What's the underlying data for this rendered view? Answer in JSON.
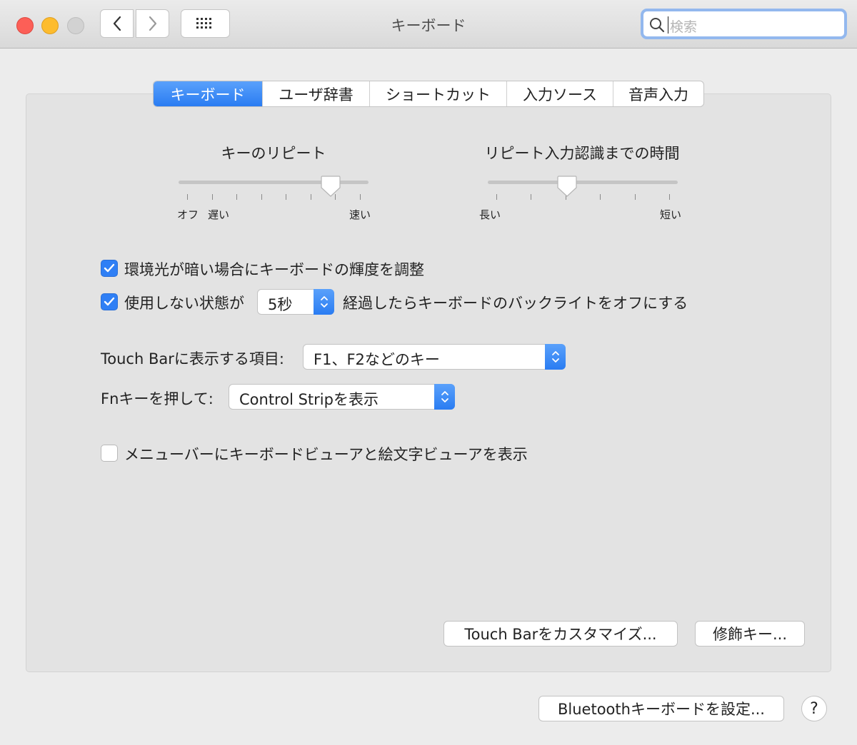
{
  "window": {
    "title": "キーボード"
  },
  "toolbar": {
    "back_icon": "chevron-left-icon",
    "forward_icon": "chevron-right-icon",
    "grid_icon": "grid-icon",
    "search_placeholder": "検索"
  },
  "tabs": [
    {
      "label": "キーボード",
      "active": true
    },
    {
      "label": "ユーザ辞書",
      "active": false
    },
    {
      "label": "ショートカット",
      "active": false
    },
    {
      "label": "入力ソース",
      "active": false
    },
    {
      "label": "音声入力",
      "active": false
    }
  ],
  "key_repeat": {
    "title": "キーのリピート",
    "label_off": "オフ",
    "label_slow": "遅い",
    "label_fast": "速い",
    "level": 0.83
  },
  "delay_until_repeat": {
    "title": "リピート入力認識までの時間",
    "label_long": "長い",
    "label_short": "短い",
    "level": 0.41
  },
  "options": {
    "adjust_brightness": {
      "label": "環境光が暗い場合にキーボードの輝度を調整",
      "checked": true
    },
    "backlight_off": {
      "label_before": "使用しない状態が",
      "value": "5秒",
      "label_after": "経過したらキーボードのバックライトをオフにする",
      "checked": true
    },
    "touch_bar": {
      "label": "Touch Barに表示する項目:",
      "value": "F1、F2などのキー"
    },
    "fn_key": {
      "label": "Fnキーを押して:",
      "value": "Control Stripを表示"
    },
    "show_viewers": {
      "label": "メニューバーにキーボードビューアと絵文字ビューアを表示",
      "checked": false
    }
  },
  "buttons": {
    "customize_touch_bar": "Touch Barをカスタマイズ...",
    "modifier_keys": "修飾キー...",
    "bluetooth_keyboard": "Bluetoothキーボードを設定...",
    "help": "?"
  },
  "colors": {
    "accent": "#2f7ff5",
    "close": "#fc5f57",
    "minimize": "#fdbc2e"
  }
}
